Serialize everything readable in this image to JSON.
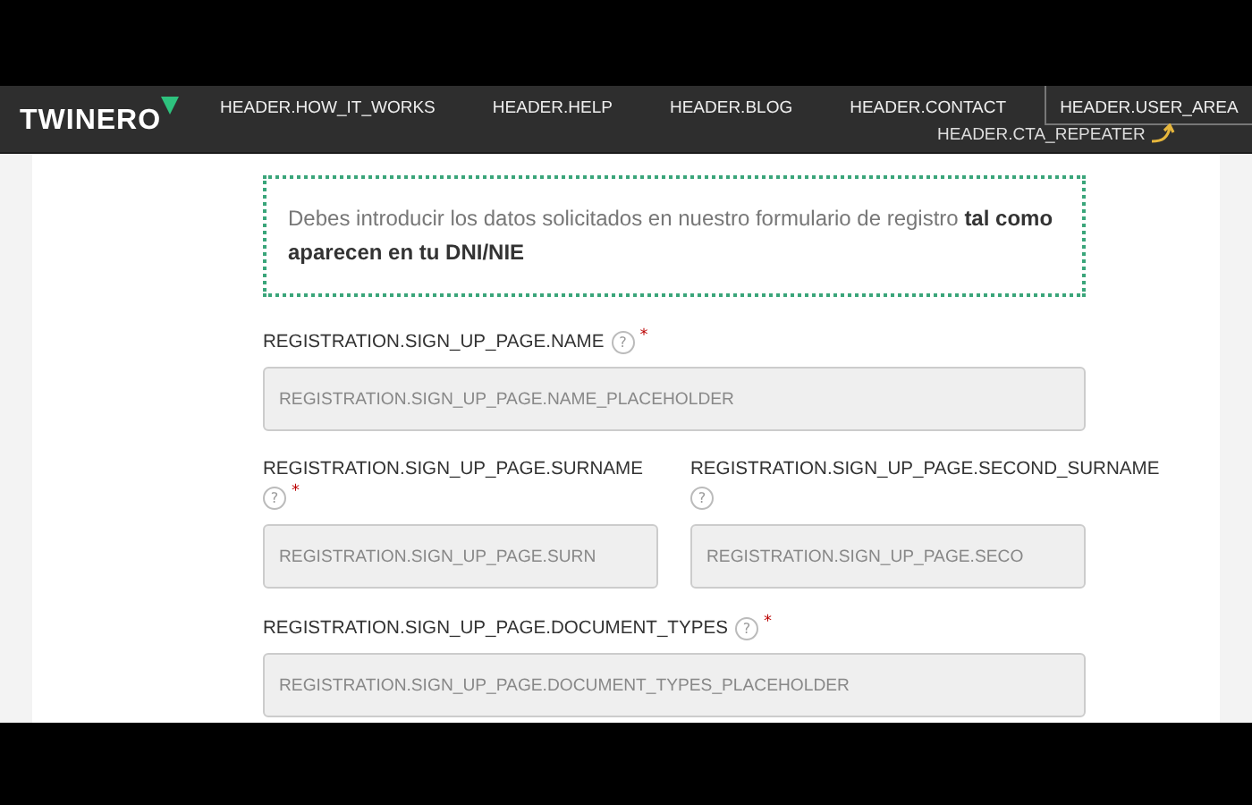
{
  "header": {
    "logo": "TWINERO",
    "nav": [
      {
        "label": "HEADER.HOW_IT_WORKS",
        "kind": "link"
      },
      {
        "label": "HEADER.HELP",
        "kind": "link"
      },
      {
        "label": "HEADER.BLOG",
        "kind": "link"
      },
      {
        "label": "HEADER.CONTACT",
        "kind": "link"
      },
      {
        "label": "HEADER.USER_AREA",
        "kind": "outlined"
      }
    ],
    "cta_hint": "HEADER.CTA_REPEATER"
  },
  "notice": {
    "text": "Debes introducir los datos solicitados en nuestro formulario de registro **tal como aparecen en tu DNI/NIE**"
  },
  "rows": [
    {
      "fields": [
        {
          "label": "REGISTRATION.SIGN_UP_PAGE.NAME",
          "help": "?",
          "required_mark": "*",
          "placeholder": "REGISTRATION.SIGN_UP_PAGE.NAME_PLACEHOLDER"
        }
      ]
    },
    {
      "fields": [
        {
          "label": "REGISTRATION.SIGN_UP_PAGE.SURNAME",
          "help": "?",
          "required_mark": "*",
          "placeholder": "REGISTRATION.SIGN_UP_PAGE.SURN"
        },
        {
          "label": "REGISTRATION.SIGN_UP_PAGE.SECOND_SURNAME",
          "help": "?",
          "placeholder": "REGISTRATION.SIGN_UP_PAGE.SECO"
        }
      ]
    },
    {
      "fields": [
        {
          "label": "REGISTRATION.SIGN_UP_PAGE.DOCUMENT_TYPES",
          "help": "?",
          "required_mark": "*",
          "placeholder": "REGISTRATION.SIGN_UP_PAGE.DOCUMENT_TYPES_PLACEHOLDER"
        }
      ]
    }
  ]
}
